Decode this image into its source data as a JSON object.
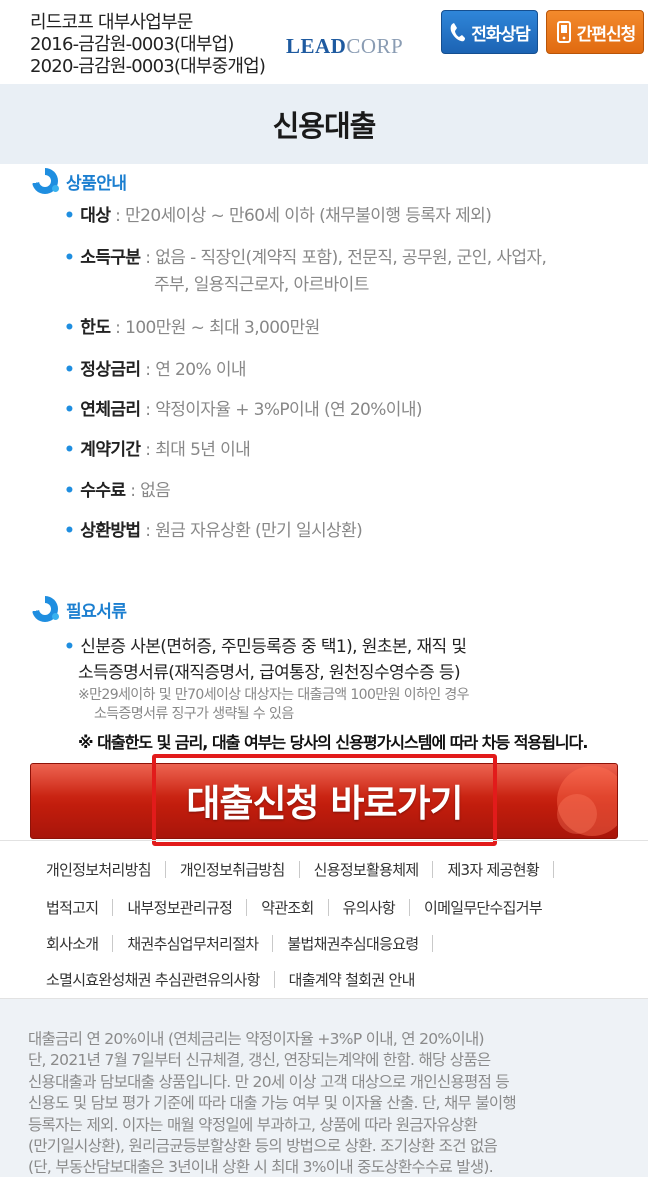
{
  "header": {
    "company_lines": [
      "리드코프 대부사업부문",
      "2016-금감원-0003(대부업)",
      "2020-금감원-0003(대부중개업)"
    ],
    "logo_lead": "LEAD",
    "logo_corp": "CORP",
    "call_button": "전화상담",
    "apply_button": "간편신청",
    "call_color": "#1f74c8",
    "apply_color": "#ee7a1e"
  },
  "page_title": "신용대출",
  "product": {
    "heading": "상품안내",
    "items": [
      {
        "key": "대상",
        "value": " : 만20세이상 ~ 만60세 이하 (채무불이행 등록자 제외)"
      },
      {
        "key": "소득구분",
        "value": " : 없음 - 직장인(계약직 포함), 전문직, 공무원, 군인, 사업자,",
        "value2": "주부, 일용직근로자, 아르바이트"
      },
      {
        "key": "한도",
        "value": " : 100만원 ~ 최대 3,000만원"
      },
      {
        "key": "정상금리",
        "value": " : 연 20% 이내"
      },
      {
        "key": "연체금리",
        "value": " : 약정이자율 + 3%P이내 (연 20%이내)"
      },
      {
        "key": "계약기간",
        "value": " : 최대 5년 이내"
      },
      {
        "key": "수수료",
        "value": " : 없음"
      },
      {
        "key": "상환방법",
        "value": " : 원금 자유상환 (만기 일시상환)"
      }
    ]
  },
  "docs": {
    "heading": "필요서류",
    "line1": "신분증 사본(면허증, 주민등록증 중 택1), 원초본, 재직 및",
    "line2": "소득증명서류(재직증명서, 급여통장, 원천징수영수증 등)",
    "note1": "※만29세이하 및 만70세이상 대상자는 대출금액 100만원 이하인 경우",
    "note2": "소득증명서류 징구가 생략될 수 있음",
    "notice": "※ 대출한도 및 금리, 대출 여부는 당사의 신용평가시스템에 따라 차등 적용됩니다."
  },
  "cta": {
    "label": "대출신청 바로가기",
    "color": "#c21d0d"
  },
  "footer_links": {
    "row1": [
      "개인정보처리방침",
      "개인정보취급방침",
      "신용정보활용체제",
      "제3자 제공현황"
    ],
    "row2": [
      "법적고지",
      "내부정보관리규정",
      "약관조회",
      "유의사항",
      "이메일무단수집거부"
    ],
    "row3": [
      "회사소개",
      "채권추심업무처리절차",
      "불법채권추심대응요령"
    ],
    "row4": [
      "소멸시효완성채권 추심관련유의사항",
      "대출계약 철회권 안내"
    ]
  },
  "disclaimer": [
    "대출금리 연 20%이내 (연체금리는 약정이자율 +3%P 이내, 연 20%이내)",
    "단, 2021년 7월 7일부터 신규체결, 갱신, 연장되는계약에 한함. 해당 상품은",
    "신용대출과 담보대출 상품입니다. 만 20세 이상 고객 대상으로 개인신용평점 등",
    "신용도 및 담보 평가 기준에 따라 대출 가능 여부 및 이자율 산출. 단, 채무 불이행",
    "등록자는 제외. 이자는 매월 약정일에 부과하고, 상품에 따라 원금자유상환",
    "(만기일시상환), 원리금균등분할상환 등의 방법으로 상환. 조기상환 조건 없음",
    "(단, 부동산담보대출은 3년이내 상환 시 최대 3%이내 중도상환수수료 발생)."
  ]
}
